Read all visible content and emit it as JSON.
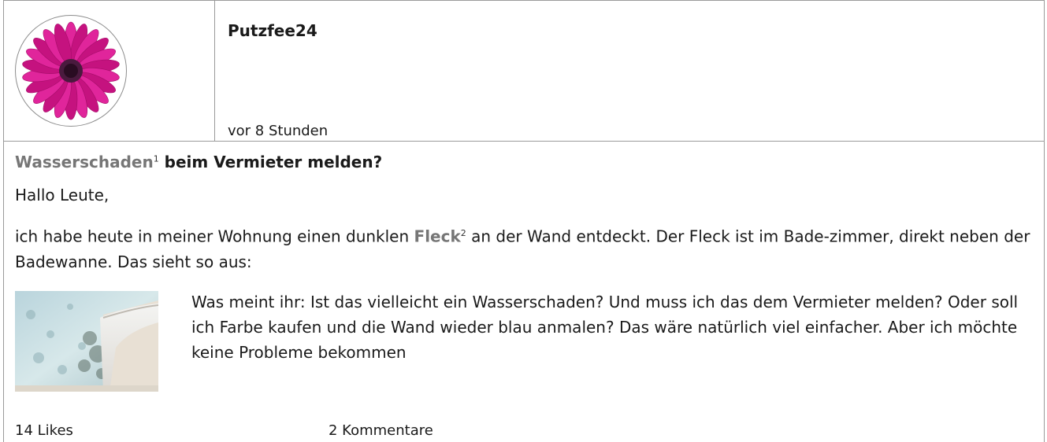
{
  "post": {
    "username": "Putzfee24",
    "time": "vor 8 Stunden",
    "title_gloss": "Wasserschaden",
    "title_gloss_sup": "1",
    "title_rest": " beim Vermieter melden?",
    "greeting": "Hallo Leute,",
    "para1_a": "ich habe heute in meiner Wohnung einen dunklen ",
    "para1_gloss": "Fleck",
    "para1_gloss_sup": "2",
    "para1_b": " an der Wand entdeckt. Der Fleck ist im Bade-zimmer, direkt neben der Badewanne. Das sieht so aus:",
    "para2": "Was meint ihr: Ist das vielleicht ein Wasserschaden? Und muss ich das dem Vermieter melden? Oder soll ich Farbe kaufen und die Wand wieder blau anmalen? Das wäre natürlich viel einfacher. Aber ich möchte keine Probleme bekommen",
    "likes": "14 Likes",
    "comments": "2 Kommentare"
  },
  "icons": {
    "avatar": "flower-avatar-icon",
    "photo": "bathroom-wall-photo"
  },
  "colors": {
    "border": "#9a9a9a",
    "gloss_word": "#767676",
    "flower": "#d2148f",
    "flower_center": "#3a1030",
    "wall": "#c8dfe4"
  }
}
